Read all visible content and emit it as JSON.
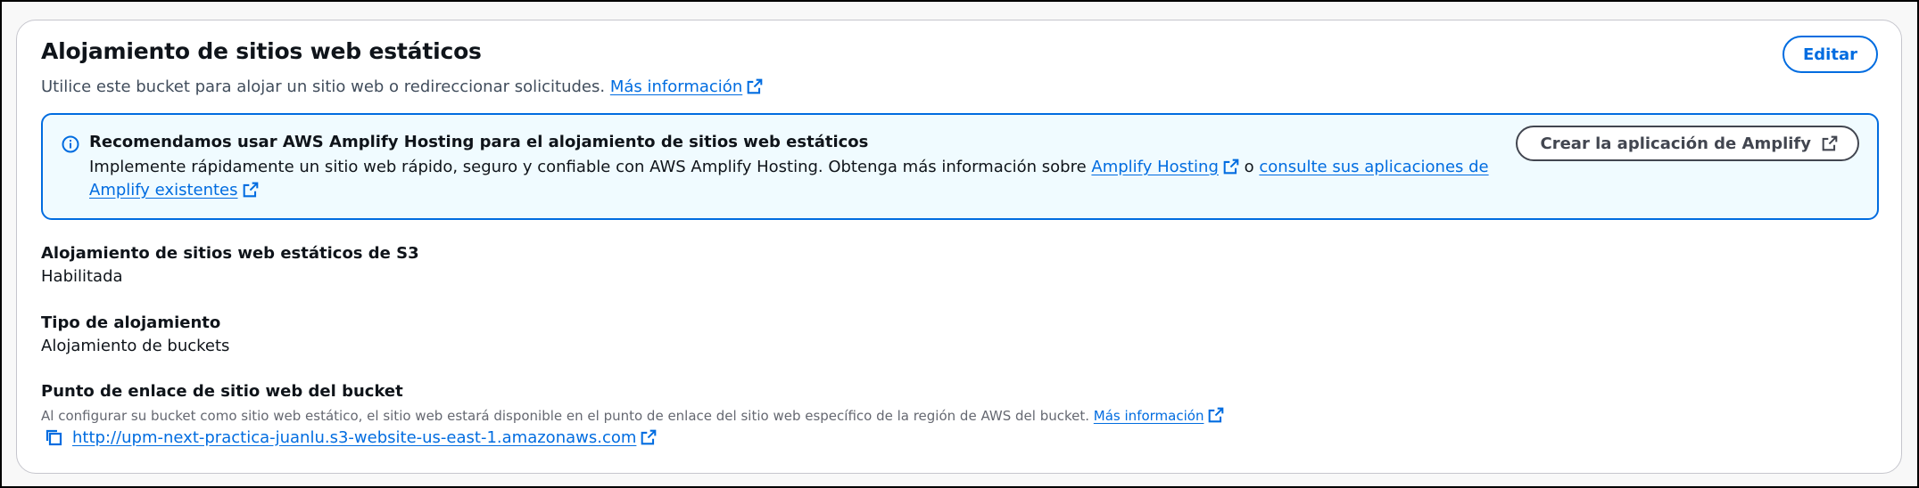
{
  "section": {
    "title": "Alojamiento de sitios web estáticos",
    "description": "Utilice este bucket para alojar un sitio web o redireccionar solicitudes.",
    "more_info_link": "Más información",
    "edit_button": "Editar"
  },
  "alert": {
    "title": "Recomendamos usar AWS Amplify Hosting para el alojamiento de sitios web estáticos",
    "body_prefix": "Implemente rápidamente un sitio web rápido, seguro y confiable con AWS Amplify Hosting. Obtenga más información sobre",
    "amplify_hosting_link": "Amplify Hosting",
    "connector": "o",
    "consult_link": "consulte sus aplicaciones de Amplify existentes",
    "create_button": "Crear la aplicación de Amplify"
  },
  "fields": {
    "s3_hosting": {
      "label": "Alojamiento de sitios web estáticos de S3",
      "value": "Habilitada"
    },
    "hosting_type": {
      "label": "Tipo de alojamiento",
      "value": "Alojamiento de buckets"
    },
    "endpoint": {
      "label": "Punto de enlace de sitio web del bucket",
      "hint": "Al configurar su bucket como sitio web estático, el sitio web estará disponible en el punto de enlace del sitio web específico de la región de AWS del bucket.",
      "hint_link": "Más información",
      "url": "http://upm-next-practica-juanlu.s3-website-us-east-1.amazonaws.com"
    }
  },
  "colors": {
    "link": "#006ce0",
    "alert_bg": "#f0fbff",
    "alert_border": "#006ce0",
    "text": "#0f141a",
    "muted": "#656871"
  }
}
